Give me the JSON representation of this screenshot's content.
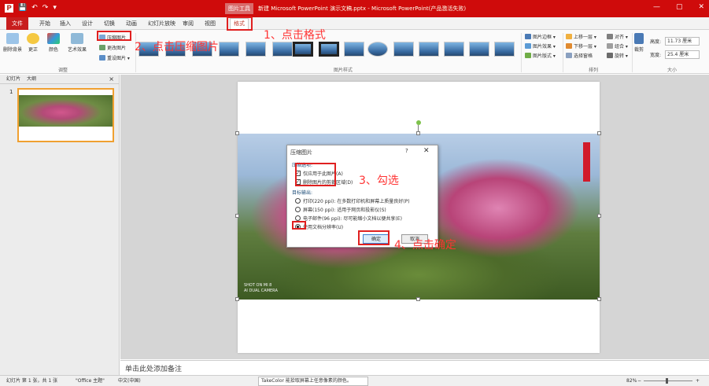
{
  "titlebar": {
    "logo": "P",
    "quick_access": [
      "💾",
      "↶",
      "↷",
      "▾"
    ],
    "context_tab": "图片工具",
    "doc_title": "新建 Microsoft PowerPoint 演示文稿.pptx - Microsoft PowerPoint(产品激活失败)",
    "min": "—",
    "restore": "▢",
    "close": "✕"
  },
  "tabs": [
    "开始",
    "插入",
    "设计",
    "切换",
    "动画",
    "幻灯片放映",
    "审阅",
    "视图"
  ],
  "file_tab": "文件",
  "format_tab": "格式",
  "ribbon": {
    "remove_bg": "删除背景",
    "corrections": "更正",
    "color": "颜色",
    "artistic": "艺术效果",
    "compress": "压缩图片",
    "change_pic": "更改图片",
    "reset_pic": "重设图片 ▾",
    "adjust_label": "调整",
    "styles_label": "图片样式",
    "border": "图片边框 ▾",
    "effects": "图片效果 ▾",
    "layout": "图片版式 ▾",
    "arrange_label": "排列",
    "bring_forward": "上移一层 ▾",
    "send_backward": "下移一层 ▾",
    "selection_pane": "选择窗格",
    "align": "对齐 ▾",
    "group": "组合 ▾",
    "rotate": "旋转 ▾",
    "crop": "裁剪",
    "height_label": "高度:",
    "height_value": "11.73 厘米",
    "width_label": "宽度:",
    "width_value": "25.4 厘米",
    "size_label": "大小"
  },
  "annotations": {
    "step1": "1、点击格式",
    "step2": "2、点击压缩图片",
    "step3": "3、勾选",
    "step4": "4、点击确定"
  },
  "left_pane": {
    "tab_slides": "幻灯片",
    "tab_outline": "大纲",
    "close": "×",
    "slide_number": "1"
  },
  "photo_watermark": [
    "SHOT ON MI 8",
    "AI DUAL CAMERA"
  ],
  "dialog": {
    "title": "压缩图片",
    "help": "?",
    "close": "✕",
    "section1": "压缩选项:",
    "opt_apply_only": "仅应用于此图片(A)",
    "opt_delete_crop": "删除图片的剪裁区域(D)",
    "section2": "目标输出:",
    "print": "打印(220 ppi): 在多数打印机和屏幕上质量良好(P)",
    "screen": "屏幕(150 ppi): 适用于网页和投影仪(S)",
    "email": "电子邮件(96 ppi): 尽可能缩小文档以便共享(E)",
    "doc_res": "使用文档分辨率(U)",
    "ok": "确定",
    "cancel": "取消",
    "check_mark": "✓"
  },
  "notes_placeholder": "单击此处添加备注",
  "status": {
    "slide_info": "幻灯片 第 1 张，共 1 张",
    "theme": "\"Office 主题\"",
    "lang": "中文(中国)",
    "takecolor": "TakeColor 能拾取屏幕上任意像素的颜色。",
    "zoom": "82%",
    "zoom_minus": "−",
    "zoom_plus": "+"
  },
  "colors": {
    "title_red": "#cf0b0b",
    "annotation_red": "#ff3333",
    "selected_thumb_border": "#f0a030"
  }
}
